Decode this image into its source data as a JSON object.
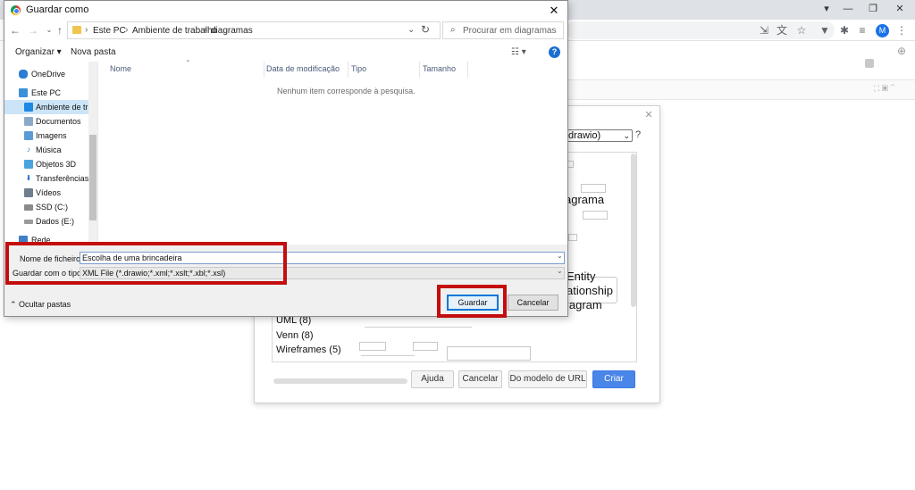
{
  "browser": {
    "profile_initial": "M"
  },
  "template_dialog": {
    "format_select": ".drawio)",
    "categories": [
      "UML (8)",
      "Venn (8)",
      "Wireframes (5)"
    ],
    "preview_texts": [
      "agrama",
      "Entity",
      "ationship",
      "iagram"
    ],
    "buttons": {
      "help": "Ajuda",
      "cancel": "Cancelar",
      "from_url": "Do modelo de URL",
      "create": "Criar"
    }
  },
  "save_dialog": {
    "title": "Guardar como",
    "breadcrumb": [
      "Este PC",
      "Ambiente de trabalho",
      "diagramas"
    ],
    "search_placeholder": "Procurar em diagramas",
    "commands": {
      "organize": "Organizar ▾",
      "new_folder": "Nova pasta"
    },
    "nav_items": [
      {
        "label": "OneDrive",
        "icon": "cloud-icon"
      },
      {
        "label": "Este PC",
        "icon": "computer-icon"
      },
      {
        "label": "Ambiente de trabalho",
        "icon": "desktop-icon",
        "selected": true
      },
      {
        "label": "Documentos",
        "icon": "documents-icon"
      },
      {
        "label": "Imagens",
        "icon": "pictures-icon"
      },
      {
        "label": "Música",
        "icon": "music-icon"
      },
      {
        "label": "Objetos 3D",
        "icon": "cube-icon"
      },
      {
        "label": "Transferências",
        "icon": "download-icon"
      },
      {
        "label": "Vídeos",
        "icon": "video-icon"
      },
      {
        "label": "SSD (C:)",
        "icon": "drive-icon"
      },
      {
        "label": "Dados (E:)",
        "icon": "drive-icon"
      },
      {
        "label": "Rede",
        "icon": "network-icon"
      }
    ],
    "columns": [
      "Nome",
      "Data de modificação",
      "Tipo",
      "Tamanho"
    ],
    "empty_message": "Nenhum item corresponde à pesquisa.",
    "filename_label": "Nome de ficheiro:",
    "filename_value": "Escolha de uma brincadeira",
    "filetype_label": "Guardar com o tipo:",
    "filetype_value": "XML File (*.drawio;*.xml;*.xslt;*.xbl;*.xsl)",
    "hide_folders": "Ocultar pastas",
    "save_button": "Guardar",
    "cancel_button": "Cancelar"
  },
  "colors": {
    "annotation_red": "#c40d0d",
    "create_button": "#4a86e8",
    "selected_nav": "#cce4f7"
  }
}
